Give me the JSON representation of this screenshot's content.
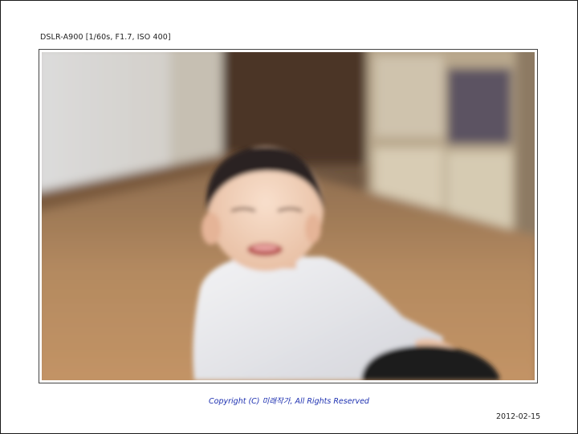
{
  "camera_info": "DSLR-A900 [1/60s, F1.7, ISO 400]",
  "copyright": "Copyright (C) 미래작가, All Rights Reserved",
  "date": "2012-02-15",
  "photo": {
    "subject": "smiling-toddler-icon",
    "colors": {
      "floor": "#b08459",
      "wall": "#d9d6d0",
      "shirt": "#e9e9ec",
      "skin": "#f1d4bf",
      "hair": "#2a2320"
    }
  }
}
